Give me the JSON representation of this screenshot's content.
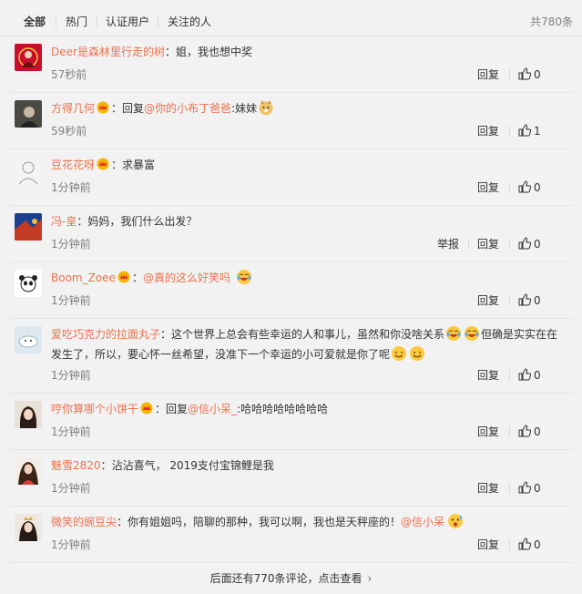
{
  "tabs": {
    "items": [
      {
        "label": "全部",
        "active": true
      },
      {
        "label": "热门",
        "active": false
      },
      {
        "label": "认证用户",
        "active": false
      },
      {
        "label": "关注的人",
        "active": false
      }
    ],
    "total": "共780条"
  },
  "actions": {
    "reply": "回复",
    "report": "举报",
    "colon": "："
  },
  "comments": [
    {
      "user": "Deer是森林里行走的树",
      "vip": false,
      "text": "姐，我也想中奖",
      "time": "57秒前",
      "likes": "0",
      "avatar": "woman-red-icon"
    },
    {
      "user": "方得几何",
      "vip": true,
      "reply_prefix": "回复",
      "mention": "@你的小布丁爸爸",
      "text": ":妹妹",
      "emoji": "doge-emoji",
      "time": "59秒前",
      "likes": "1",
      "avatar": "dark-portrait-icon"
    },
    {
      "user": "豆花花呀",
      "vip": true,
      "text": "求暴富",
      "time": "1分钟前",
      "likes": "0",
      "avatar": "sketch-face-icon"
    },
    {
      "user": "冯-皇",
      "vip": false,
      "text": "妈妈，我们什么出发？",
      "time": "1分钟前",
      "likes": "0",
      "report": true,
      "avatar": "abstract-blue-icon"
    },
    {
      "user": "Boom_Zoee",
      "vip": true,
      "mention": "@真的这么好笑吗",
      "text": "",
      "emoji": "laugh-cry-emoji",
      "time": "1分钟前",
      "likes": "0",
      "avatar": "panda-icon"
    },
    {
      "user": "爱吃巧克力的拉面丸子",
      "vip": false,
      "line1_a": "这个世界上总会有些幸运的人和事儿，虽然和你没啥关系",
      "line1_b": "但确是实实在在",
      "line2": "发生了，所以，要心怀一丝希望，没准下一个幸运的小可爱就是你了呢",
      "time": "1分钟前",
      "likes": "0",
      "avatar": "cartoon-cloud-icon"
    },
    {
      "user": "哼你算哪个小饼干",
      "vip": true,
      "reply_prefix": "回复",
      "mention": "@信小呆_",
      "text": ":哈哈哈哈哈哈哈哈",
      "time": "1分钟前",
      "likes": "0",
      "avatar": "girl-portrait-icon"
    },
    {
      "user": "魅雪2820",
      "vip": false,
      "text": "沾沾喜气， 2019支付宝锦鲤是我",
      "time": "1分钟前",
      "likes": "0",
      "avatar": "girl-red-dress-icon"
    },
    {
      "user": "微笑的豌豆尖",
      "vip": false,
      "text": "你有姐姐吗，陪聊的那种，我可以啊，我也是天秤座的！",
      "mention": "@信小呆",
      "emoji": "surprised-emoji",
      "time": "1分钟前",
      "likes": "0",
      "avatar": "woman-crown-icon"
    }
  ],
  "footer": {
    "more": "后面还有770条评论，点击查看"
  },
  "colors": {
    "username": "#eb7350",
    "meta": "#808080",
    "background": "#f2f2f2"
  }
}
